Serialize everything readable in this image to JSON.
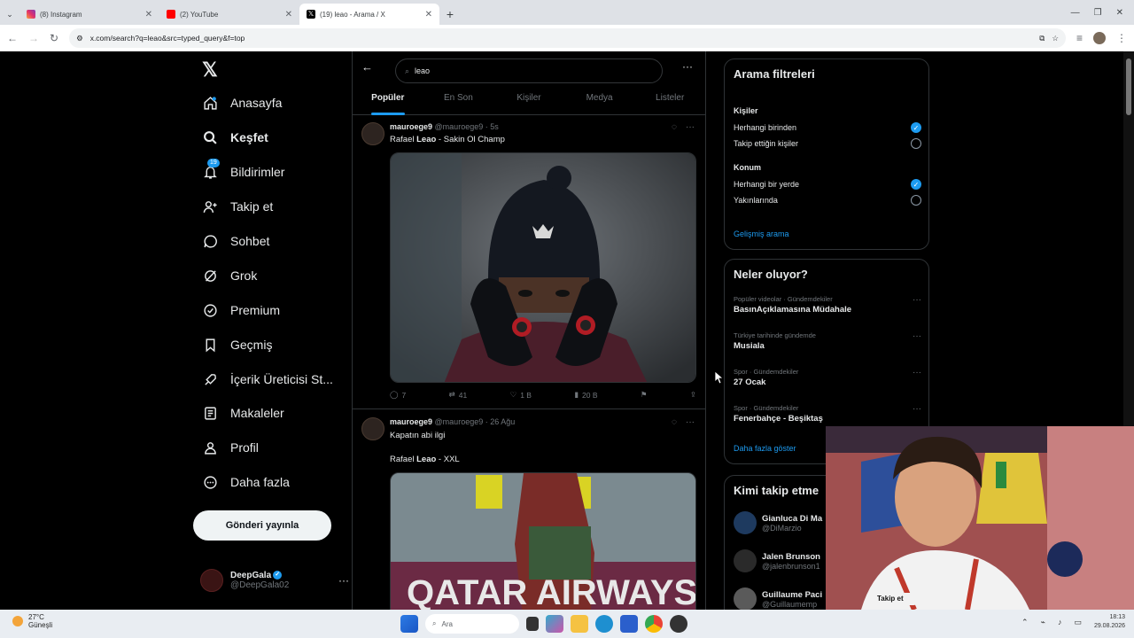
{
  "browser": {
    "tabs": [
      {
        "label": "(8) Instagram",
        "color": "#e1306c"
      },
      {
        "label": "(2) YouTube",
        "color": "#ff0000"
      },
      {
        "label": "(19) leao - Arama / X",
        "color": "#000000"
      }
    ],
    "url": "x.com/search?q=leao&src=typed_query&f=top"
  },
  "nav": {
    "items": [
      {
        "label": "Anasayfa",
        "icon": "home-icon"
      },
      {
        "label": "Keşfet",
        "icon": "search-icon"
      },
      {
        "label": "Bildirimler",
        "icon": "bell-icon",
        "badge": "19"
      },
      {
        "label": "Takip et",
        "icon": "follow-icon"
      },
      {
        "label": "Sohbet",
        "icon": "chat-icon"
      },
      {
        "label": "Grok",
        "icon": "grok-icon"
      },
      {
        "label": "Premium",
        "icon": "premium-icon"
      },
      {
        "label": "Geçmiş",
        "icon": "bookmark-icon"
      },
      {
        "label": "İçerik Üreticisi St...",
        "icon": "rocket-icon"
      },
      {
        "label": "Makaleler",
        "icon": "articles-icon"
      },
      {
        "label": "Profil",
        "icon": "profile-icon"
      },
      {
        "label": "Daha fazla",
        "icon": "more-icon"
      }
    ],
    "post_button": "Gönderi yayınla",
    "account": {
      "name": "DeepGala",
      "handle": "@DeepGala02"
    }
  },
  "search": {
    "query": "leao"
  },
  "tabs": [
    "Popüler",
    "En Son",
    "Kişiler",
    "Medya",
    "Listeler"
  ],
  "tweets": [
    {
      "name": "mauroege9",
      "handle": "@mauroege9",
      "time": "· 5s",
      "text_pre": "Rafael ",
      "text_bold": "Leao",
      "text_post": " - Sakin Ol Champ",
      "replies": "7",
      "reposts": "41",
      "likes": "1 B",
      "views": "20 B"
    },
    {
      "name": "mauroege9",
      "handle": "@mauroege9",
      "time": "· 26 Ağu",
      "line1": "Kapatın abi ilgi",
      "text_pre": "Rafael ",
      "text_bold": "Leao",
      "text_post": " - XXL"
    }
  ],
  "filters": {
    "title": "Arama filtreleri",
    "people_label": "Kişiler",
    "people_opt1": "Herhangi birinden",
    "people_opt2": "Takip ettiğin kişiler",
    "location_label": "Konum",
    "loc_opt1": "Herhangi bir yerde",
    "loc_opt2": "Yakınlarında",
    "advanced": "Gelişmiş arama"
  },
  "trends": {
    "title": "Neler oluyor?",
    "items": [
      {
        "meta": "Popüler videolar · Gündemdekiler",
        "title": "BasınAçıklamasına Müdahale"
      },
      {
        "meta": "Türkiye tarihinde gündemde",
        "title": "Musiala"
      },
      {
        "meta": "Spor · Gündemdekiler",
        "title": "27 Ocak"
      },
      {
        "meta": "Spor · Gündemdekiler",
        "title": "Fenerbahçe - Beşiktaş"
      }
    ],
    "more": "Daha fazla göster"
  },
  "who_to_follow": {
    "title": "Kimi takip etme",
    "items": [
      {
        "name": "Gianluca Di Ma",
        "handle": "@DiMarzio"
      },
      {
        "name": "Jalen Brunson",
        "handle": "@jalenbrunson1"
      },
      {
        "name": "Guillaume Paci",
        "handle": "@Guillaumemp"
      }
    ]
  },
  "webcam": {
    "button": "Takip et"
  },
  "taskbar": {
    "temp": "27°C",
    "weather": "Güneşli",
    "search_placeholder": "Ara",
    "time": "18:13",
    "date": "29.08.2026"
  }
}
